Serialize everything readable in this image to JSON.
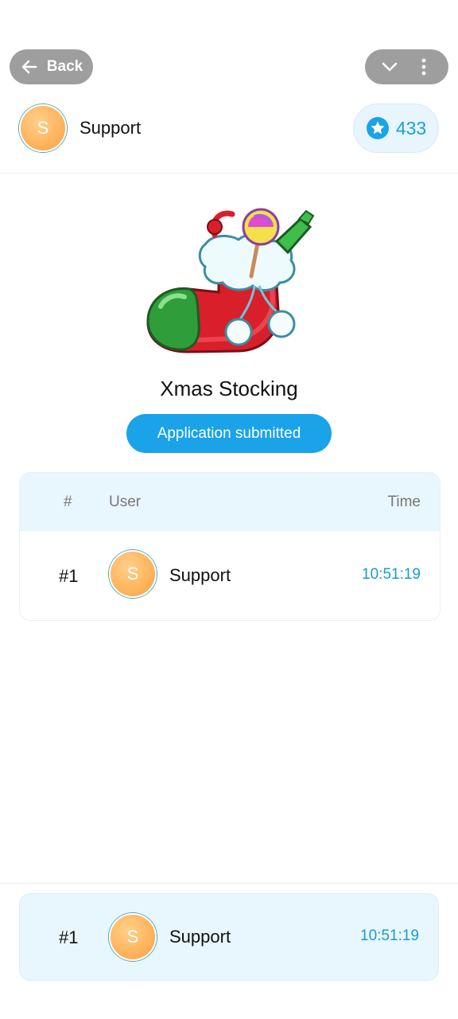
{
  "topbar": {
    "back_label": "Back"
  },
  "profile": {
    "avatar_letter": "S",
    "name": "Support",
    "score": "433"
  },
  "gift": {
    "title": "Xmas Stocking",
    "status_label": "Application submitted"
  },
  "table": {
    "headers": {
      "num": "#",
      "user": "User",
      "time": "Time"
    },
    "rows": [
      {
        "rank": "#1",
        "avatar_letter": "S",
        "user": "Support",
        "time": "10:51:19"
      }
    ]
  },
  "footer": {
    "rank": "#1",
    "avatar_letter": "S",
    "user": "Support",
    "time": "10:51:19"
  },
  "colors": {
    "accent": "#1aa3e8",
    "time_text": "#1a9bd0",
    "table_head_bg": "#e8f6fd",
    "avatar_orange": "#ffb35c",
    "topbar_pill": "#9e9e9e"
  },
  "icons": {
    "back": "arrow-left-icon",
    "chevron": "chevron-down-icon",
    "more": "more-vertical-icon",
    "star": "star-badge-icon",
    "sticker": "xmas-stocking-sticker"
  }
}
